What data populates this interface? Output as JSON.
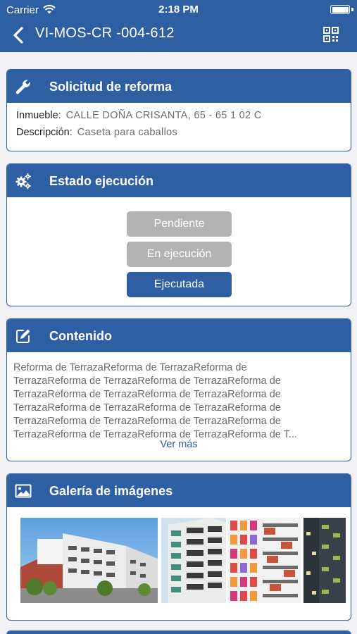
{
  "status_bar": {
    "carrier": "Carrier",
    "time": "2:18 PM"
  },
  "nav": {
    "title": "VI-MOS-CR -004-612"
  },
  "request": {
    "title": "Solicitud de reforma",
    "property_label": "Inmueble:",
    "property_value": "CALLE DOÑA CRISANTA, 65 - 65 1 02 C",
    "description_label": "Descripción:",
    "description_value": "Caseta para caballos"
  },
  "execution": {
    "title": "Estado ejecución",
    "states": [
      "Pendiente",
      "En ejecución",
      "Ejecutada"
    ],
    "selected": "Ejecutada"
  },
  "content": {
    "title": "Contenido",
    "lines": [
      "Reforma de TerrazaReforma de TerrazaReforma de",
      "TerrazaReforma de TerrazaReforma de TerrazaReforma de",
      "TerrazaReforma de TerrazaReforma de TerrazaReforma de",
      "TerrazaReforma de TerrazaReforma de TerrazaReforma de",
      "TerrazaReforma de TerrazaReforma de TerrazaReforma de",
      "TerrazaReforma de TerrazaReforma de TerrazaReforma de T..."
    ],
    "more_link": "Ver más"
  },
  "gallery": {
    "title": "Galería de imágenes"
  },
  "colors": {
    "primary": "#2f5fa3",
    "disabled": "#b3b3b3",
    "background": "#f2f2f4"
  }
}
